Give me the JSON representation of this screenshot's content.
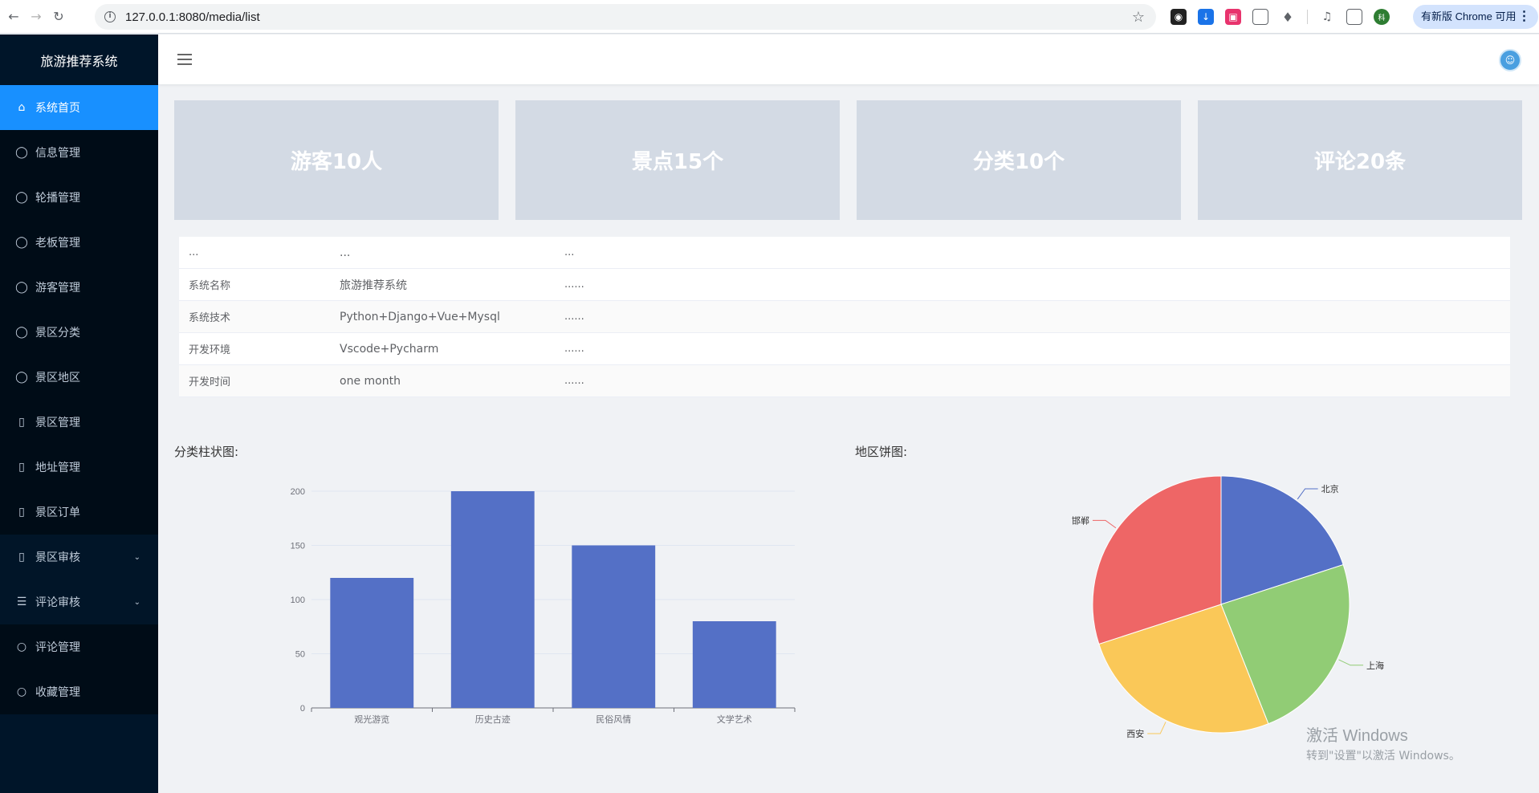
{
  "browser": {
    "url": "127.0.0.1:8080/media/list",
    "update_label": "有新版 Chrome 可用",
    "profile_initial": "科"
  },
  "sidebar": {
    "title": "旅游推荐系统",
    "items": [
      {
        "label": "系统首页",
        "icon": "home-icon",
        "active": true
      },
      {
        "label": "信息管理",
        "icon": "user-icon"
      },
      {
        "label": "轮播管理",
        "icon": "user-icon"
      },
      {
        "label": "老板管理",
        "icon": "user-icon"
      },
      {
        "label": "游客管理",
        "icon": "user-icon"
      },
      {
        "label": "景区分类",
        "icon": "user-icon"
      },
      {
        "label": "景区地区",
        "icon": "user-icon"
      },
      {
        "label": "景区管理",
        "icon": "document-icon"
      },
      {
        "label": "地址管理",
        "icon": "document-icon"
      },
      {
        "label": "景区订单",
        "icon": "document-icon"
      },
      {
        "label": "景区审核",
        "icon": "document-icon",
        "has_submenu": true
      },
      {
        "label": "评论审核",
        "icon": "list-icon",
        "has_submenu": true
      },
      {
        "label": "评论管理",
        "icon": "chat-icon"
      },
      {
        "label": "收藏管理",
        "icon": "chat-icon"
      }
    ]
  },
  "stats": [
    {
      "label": "游客10人"
    },
    {
      "label": "景点15个"
    },
    {
      "label": "分类10个"
    },
    {
      "label": "评论20条"
    }
  ],
  "info_table": {
    "header": [
      "...",
      "...",
      "..."
    ],
    "rows": [
      [
        "系统名称",
        "旅游推荐系统",
        "......"
      ],
      [
        "系统技术",
        "Python+Django+Vue+Mysql",
        "......"
      ],
      [
        "开发环境",
        "Vscode+Pycharm",
        "......"
      ],
      [
        "开发时间",
        "one month",
        "......"
      ]
    ]
  },
  "bar_title": "分类柱状图:",
  "pie_title": "地区饼图:",
  "chart_data": [
    {
      "type": "bar",
      "categories": [
        "观光游览",
        "历史古迹",
        "民俗风情",
        "文学艺术"
      ],
      "values": [
        120,
        200,
        150,
        80
      ],
      "ylim": [
        0,
        200
      ],
      "yticks": [
        0,
        50,
        100,
        150,
        200
      ],
      "color": "#5470c6",
      "grid": true
    },
    {
      "type": "pie",
      "labels": [
        "北京",
        "上海",
        "西安",
        "邯郸"
      ],
      "values": [
        20,
        24,
        26,
        30
      ],
      "colors": [
        "#5470c6",
        "#91cc75",
        "#fac858",
        "#ee6666"
      ]
    }
  ],
  "watermark": {
    "line1": "激活 Windows",
    "line2": "转到\"设置\"以激活 Windows。"
  }
}
